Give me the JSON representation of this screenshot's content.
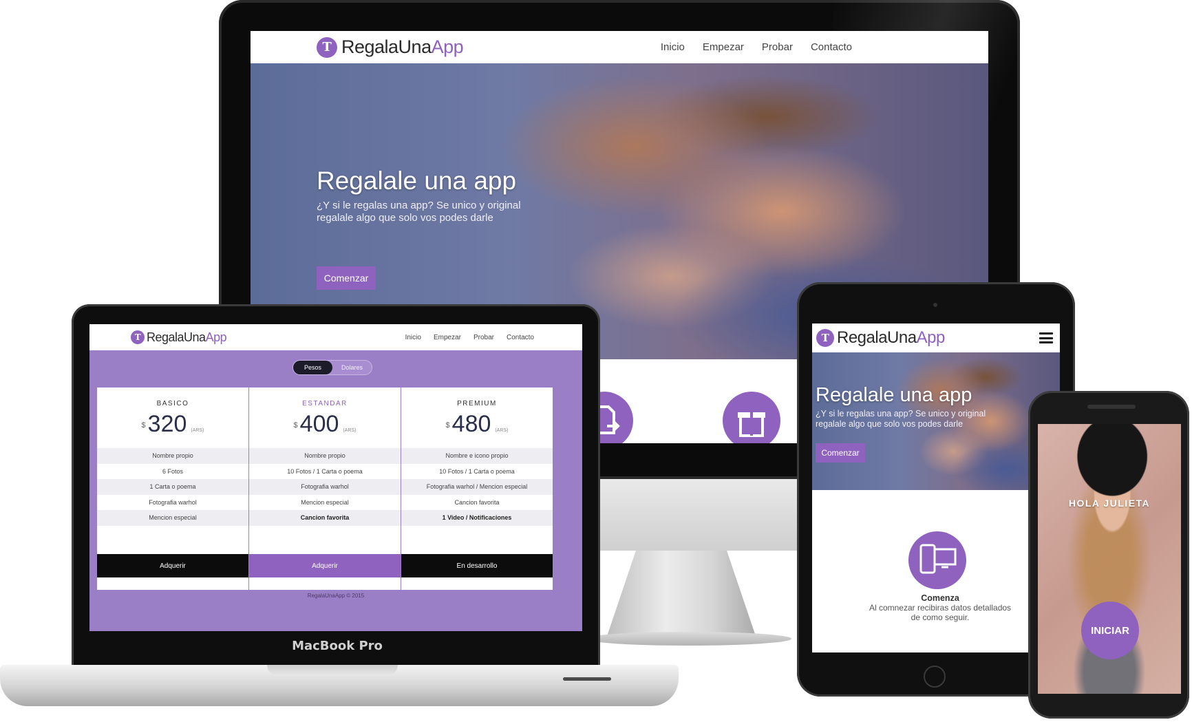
{
  "brand": {
    "name_prefix": "RegalaUna",
    "name_suffix": "App",
    "mark": "T",
    "accent_color": "#8e62be"
  },
  "nav": [
    "Inicio",
    "Empezar",
    "Probar",
    "Contacto"
  ],
  "hero": {
    "title": "Regalale una app",
    "subtitle": "¿Y si le regalas una app? Se unico y original regalale algo que solo vos podes darle",
    "cta": "Comenzar"
  },
  "pricing": {
    "toggle": [
      "Pesos",
      "Dolares"
    ],
    "currency_symbol": "$",
    "currency_code": "(ARS)",
    "plans": [
      {
        "name": "BASICO",
        "price": "320",
        "features": [
          "Nombre propio",
          "6 Fotos",
          "1 Carta o poema",
          "Fotografia warhol",
          "Mencion especial"
        ],
        "cta": "Adquerir"
      },
      {
        "name": "ESTANDAR",
        "price": "400",
        "features": [
          "Nombre propio",
          "10 Fotos / 1 Carta o poema",
          "Fotografia warhol",
          "Mencion especial",
          "Cancion favorita"
        ],
        "cta": "Adquerir"
      },
      {
        "name": "PREMIUM",
        "price": "480",
        "features": [
          "Nombre e icono propio",
          "10 Fotos / 1 Carta o poema",
          "Fotografia warhol / Mencion especial",
          "Cancion favorita",
          "1 Video / Notificaciones"
        ],
        "cta": "En desarrollo"
      }
    ],
    "footer": "RegalaUnaApp © 2015"
  },
  "device_labels": {
    "laptop": "MacBook Pro"
  },
  "tablet_feature": {
    "title": "Comenza",
    "text": "Al comnezar recibiras datos detallados de como seguir."
  },
  "phone": {
    "greeting": "HOLA JULIETA",
    "cta": "INICIAR"
  }
}
